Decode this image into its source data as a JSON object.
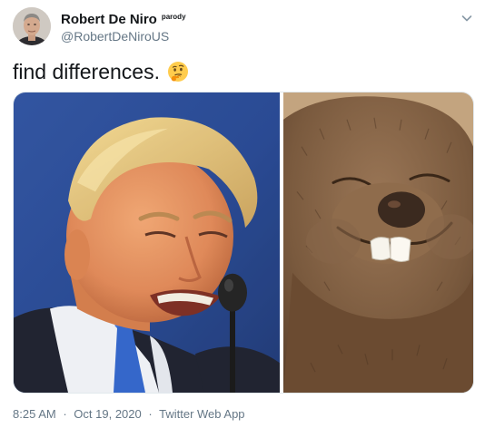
{
  "author": {
    "display_name": "Robert De Niro",
    "parody_label": "parody",
    "handle": "@RobertDeNiroUS",
    "avatar_icon": "profile-photo"
  },
  "tweet": {
    "text": "find differences.",
    "emoji_icon": "thinking-face-emoji"
  },
  "media": {
    "left_photo": "photo-man-grimacing",
    "right_photo": "photo-beaver-smiling"
  },
  "meta": {
    "time": "8:25 AM",
    "separator": "·",
    "date": "Oct 19, 2020",
    "source": "Twitter Web App"
  },
  "colors": {
    "text_primary": "#14171a",
    "text_secondary": "#657786",
    "border": "#e1e8ed"
  }
}
